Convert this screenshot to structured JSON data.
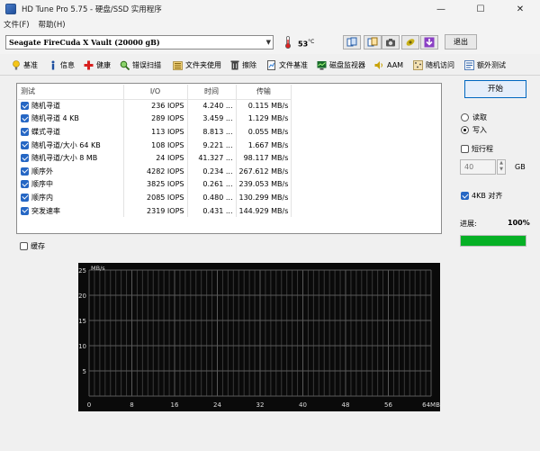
{
  "window": {
    "title": "HD Tune Pro 5.75 - 硬盘/SSD 实用程序",
    "controls": {
      "minimize": "—",
      "maximize": "☐",
      "close": "✕"
    }
  },
  "menu": [
    "文件(F)",
    "帮助(H)"
  ],
  "toolbar": {
    "drive": "Seagate FireCuda X Vault (20000 gB)",
    "temperature": "53",
    "temperature_unit": "°C",
    "exit_label": "退出",
    "icons": [
      "copy-info-icon",
      "copy-screen-icon",
      "camera-icon",
      "health-icon",
      "download-icon"
    ]
  },
  "tabs": [
    {
      "label": "基准",
      "icon": "benchmark-icon"
    },
    {
      "label": "信息",
      "icon": "info-icon"
    },
    {
      "label": "健康",
      "icon": "health-cross-icon"
    },
    {
      "label": "错误扫描",
      "icon": "error-scan-icon"
    },
    {
      "label": "文件夹使用",
      "icon": "folder-usage-icon"
    },
    {
      "label": "擦除",
      "icon": "erase-icon"
    },
    {
      "label": "文件基准",
      "icon": "file-benchmark-icon"
    },
    {
      "label": "磁盘监视器",
      "icon": "disk-monitor-icon"
    },
    {
      "label": "AAM",
      "icon": "aam-speaker-icon"
    },
    {
      "label": "随机访问",
      "icon": "random-access-icon"
    },
    {
      "label": "额外测试",
      "icon": "extra-tests-icon"
    }
  ],
  "results": {
    "headers": [
      "测试",
      "I/O",
      "时间",
      "传输"
    ],
    "rows": [
      {
        "test": "随机寻道",
        "io": "236 IOPS",
        "time": "4.240 ...",
        "transfer": "0.115 MB/s"
      },
      {
        "test": "随机寻道 4 KB",
        "io": "289 IOPS",
        "time": "3.459 ...",
        "transfer": "1.129 MB/s"
      },
      {
        "test": "蝶式寻道",
        "io": "113 IOPS",
        "time": "8.813 ...",
        "transfer": "0.055 MB/s"
      },
      {
        "test": "随机寻道/大小 64 KB",
        "io": "108 IOPS",
        "time": "9.221 ...",
        "transfer": "1.667 MB/s"
      },
      {
        "test": "随机寻道/大小 8 MB",
        "io": "24 IOPS",
        "time": "41.327 ...",
        "transfer": "98.117 MB/s"
      },
      {
        "test": "顺序外",
        "io": "4282 IOPS",
        "time": "0.234 ...",
        "transfer": "267.612 MB/s"
      },
      {
        "test": "顺序中",
        "io": "3825 IOPS",
        "time": "0.261 ...",
        "transfer": "239.053 MB/s"
      },
      {
        "test": "顺序内",
        "io": "2085 IOPS",
        "time": "0.480 ...",
        "transfer": "130.299 MB/s"
      },
      {
        "test": "突发速率",
        "io": "2319 IOPS",
        "time": "0.431 ...",
        "transfer": "144.929 MB/s"
      }
    ]
  },
  "side": {
    "start_label": "开始",
    "read_label": "读取",
    "write_label": "写入",
    "mode_selected": "写入",
    "short_stroke_label": "短行程",
    "short_stroke_checked": false,
    "size_value": "40",
    "size_unit": "GB",
    "align_label": "4KB 对齐",
    "align_checked": true,
    "progress_label": "进展:",
    "progress_value": "100%",
    "progress_fraction": 1.0,
    "progress_color": "#06b025"
  },
  "cache": {
    "label": "缓存",
    "checked": false
  },
  "graph": {
    "unit": "MB/s",
    "y_ticks": [
      "25",
      "20",
      "15",
      "10",
      "5"
    ],
    "x_ticks": [
      "0",
      "8",
      "16",
      "24",
      "32",
      "40",
      "48",
      "56",
      "64MB"
    ]
  }
}
